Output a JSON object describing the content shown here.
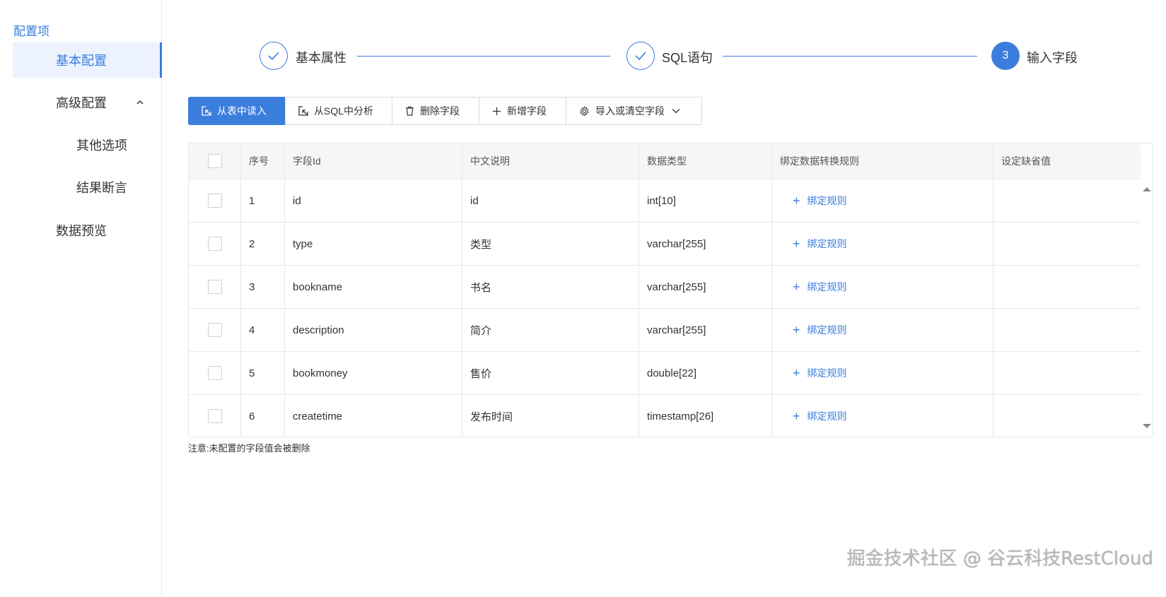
{
  "sidebar": {
    "title": "配置项",
    "items": [
      {
        "label": "基本配置"
      },
      {
        "label": "高级配置"
      },
      {
        "label": "其他选项"
      },
      {
        "label": "结果断言"
      },
      {
        "label": "数据预览"
      }
    ]
  },
  "steps": [
    {
      "label": "基本属性",
      "status": "done"
    },
    {
      "label": "SQL语句",
      "status": "done"
    },
    {
      "label": "输入字段",
      "status": "current",
      "number": "3"
    }
  ],
  "toolbar": {
    "read_from_table": "从表中读入",
    "analyze_sql": "从SQL中分析",
    "delete_field": "删除字段",
    "add_field": "新增字段",
    "import_clear": "导入或清空字段"
  },
  "table": {
    "headers": [
      "序号",
      "字段Id",
      "中文说明",
      "数据类型",
      "绑定数据转换规则",
      "设定缺省值"
    ],
    "bind_label": "绑定规则",
    "rows": [
      {
        "index": "1",
        "field": "id",
        "desc": "id",
        "type": "int[10]"
      },
      {
        "index": "2",
        "field": "type",
        "desc": "类型",
        "type": "varchar[255]"
      },
      {
        "index": "3",
        "field": "bookname",
        "desc": "书名",
        "type": "varchar[255]"
      },
      {
        "index": "4",
        "field": "description",
        "desc": "简介",
        "type": "varchar[255]"
      },
      {
        "index": "5",
        "field": "bookmoney",
        "desc": "售价",
        "type": "double[22]"
      },
      {
        "index": "6",
        "field": "createtime",
        "desc": "发布时间",
        "type": "timestamp[26]"
      }
    ]
  },
  "note": "注意:未配置的字段值会被删除",
  "watermark": "掘金技术社区 @ 谷云科技RestCloud",
  "colors": {
    "accent": "#3b7ddd",
    "active_bg": "#ecf3fe",
    "header_bg": "#f5f6f7"
  }
}
